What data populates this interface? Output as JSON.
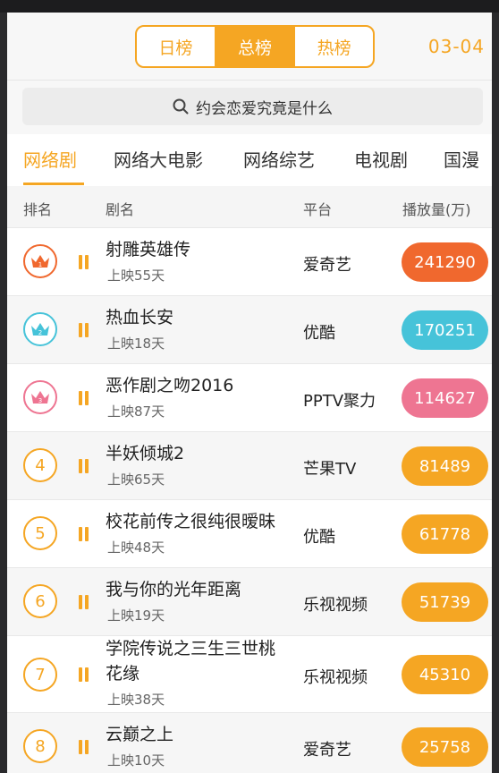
{
  "header": {
    "tabs": [
      {
        "label": "日榜",
        "active": false
      },
      {
        "label": "总榜",
        "active": true
      },
      {
        "label": "热榜",
        "active": false
      }
    ],
    "date": "03-04"
  },
  "search": {
    "text": "约会恋爱究竟是什么"
  },
  "categories": [
    {
      "label": "网络剧",
      "active": true
    },
    {
      "label": "网络大电影",
      "active": false
    },
    {
      "label": "网络综艺",
      "active": false
    },
    {
      "label": "电视剧",
      "active": false
    },
    {
      "label": "国漫",
      "active": false
    }
  ],
  "columns": {
    "rank": "排名",
    "name": "剧名",
    "platform": "平台",
    "plays": "播放量(万)"
  },
  "colors": {
    "accent": "#f5a623",
    "first": "#f0682e",
    "second": "#46c3d9",
    "third": "#ee7592"
  },
  "rows": [
    {
      "rank": "1",
      "title": "射雕英雄传",
      "sub": "上映55天",
      "platform": "爱奇艺",
      "plays": "241290",
      "color": "#f0682e",
      "crown": true
    },
    {
      "rank": "2",
      "title": "热血长安",
      "sub": "上映18天",
      "platform": "优酷",
      "plays": "170251",
      "color": "#46c3d9",
      "crown": true
    },
    {
      "rank": "3",
      "title": "恶作剧之吻2016",
      "sub": "上映87天",
      "platform": "PPTV聚力",
      "plays": "114627",
      "color": "#ee7592",
      "crown": true
    },
    {
      "rank": "4",
      "title": "半妖倾城2",
      "sub": "上映65天",
      "platform": "芒果TV",
      "plays": "81489",
      "color": "#f5a623",
      "crown": false
    },
    {
      "rank": "5",
      "title": "校花前传之很纯很暧昧",
      "sub": "上映48天",
      "platform": "优酷",
      "plays": "61778",
      "color": "#f5a623",
      "crown": false
    },
    {
      "rank": "6",
      "title": "我与你的光年距离",
      "sub": "上映19天",
      "platform": "乐视视频",
      "plays": "51739",
      "color": "#f5a623",
      "crown": false
    },
    {
      "rank": "7",
      "title": "学院传说之三生三世桃",
      "title2": "花缘",
      "sub": "上映38天",
      "platform": "乐视视频",
      "plays": "45310",
      "color": "#f5a623",
      "crown": false
    },
    {
      "rank": "8",
      "title": "云巅之上",
      "sub": "上映10天",
      "platform": "爱奇艺",
      "plays": "25758",
      "color": "#f5a623",
      "crown": false
    }
  ]
}
